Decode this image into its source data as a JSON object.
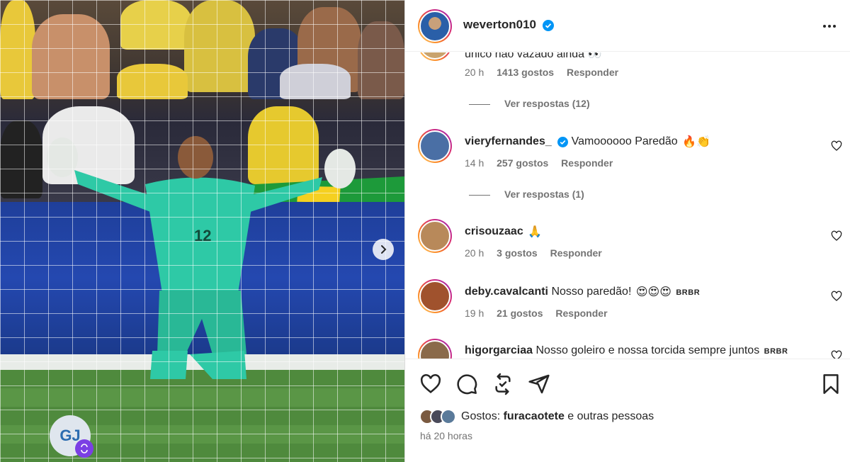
{
  "post": {
    "author": "weverton010",
    "verified": true,
    "time_ago": "há 20 horas"
  },
  "media": {
    "jersey_number": "12",
    "badge_text": "GJ",
    "next_icon": "chevron-right-icon"
  },
  "comments": [
    {
      "user": "",
      "text": "único não vazado ainda 👀",
      "time": "20 h",
      "likes": "1413 gostos",
      "reply_label": "Responder",
      "view_replies": "Ver respostas (12)",
      "avatar_color": "#c9a36d"
    },
    {
      "user": "vieryfernandes_",
      "verified": true,
      "text": "Vamoooooo Paredão",
      "emoji": "🔥👏",
      "time": "14 h",
      "likes": "257 gostos",
      "reply_label": "Responder",
      "view_replies": "Ver respostas (1)",
      "avatar_color": "#4a6fa5"
    },
    {
      "user": "crisouzaac",
      "text": "",
      "emoji": "🙏",
      "time": "20 h",
      "likes": "3 gostos",
      "reply_label": "Responder",
      "avatar_color": "#b8895a"
    },
    {
      "user": "deby.cavalcanti",
      "text": "Nosso paredão!",
      "emoji": "😍😍😍",
      "suffix": "BRBR",
      "time": "19 h",
      "likes": "21 gostos",
      "reply_label": "Responder",
      "avatar_color": "#a0522d"
    },
    {
      "user": "higorgarciaa",
      "text": "Nosso goleiro e nossa torcida sempre juntos",
      "suffix": "BRBR",
      "avatar_color": "#8a6a4a"
    }
  ],
  "actions": {
    "like_icon": "heart-icon",
    "comment_icon": "comment-icon",
    "repost_icon": "repost-icon",
    "share_icon": "send-icon",
    "save_icon": "bookmark-icon"
  },
  "likes_summary": {
    "prefix": "Gostos:",
    "user": "furacaotete",
    "suffix": "e outras pessoas"
  },
  "colors": {
    "verified_blue": "#0095f6",
    "meta_gray": "#737373",
    "text": "#262626",
    "jersey": "#2ec9a6"
  }
}
